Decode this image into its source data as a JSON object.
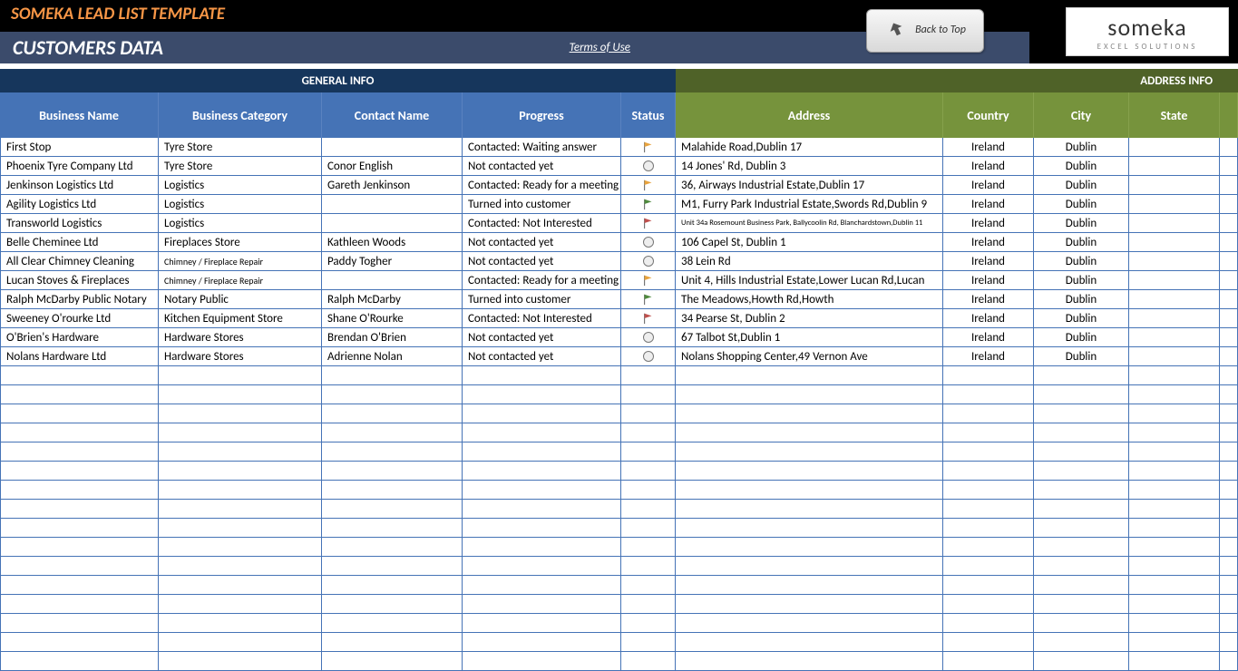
{
  "header": {
    "brand_title": "SOMEKA LEAD LIST TEMPLATE",
    "subtitle": "CUSTOMERS DATA",
    "terms_link": "Terms of Use",
    "back_button": "Back to Top",
    "logo_main": "someka",
    "logo_sub": "EXCEL SOLUTIONS"
  },
  "sections": {
    "general": "GENERAL INFO",
    "address": "ADDRESS INFO"
  },
  "columns": {
    "business_name": "Business Name",
    "business_category": "Business Category",
    "contact_name": "Contact Name",
    "progress": "Progress",
    "status": "Status",
    "address": "Address",
    "country": "Country",
    "city": "City",
    "state": "State"
  },
  "rows": [
    {
      "bn": "First Stop",
      "bc": "Tyre Store",
      "cn": "",
      "pr": "Contacted: Waiting answer",
      "st": "flag-orange",
      "ad": "Malahide Road,Dublin 17",
      "co": "Ireland",
      "ci": "Dublin",
      "sa": ""
    },
    {
      "bn": "Phoenix Tyre Company Ltd",
      "bc": "Tyre Store",
      "cn": "Conor English",
      "pr": "Not contacted yet",
      "st": "circle",
      "ad": "14 Jones' Rd, Dublin 3",
      "co": "Ireland",
      "ci": "Dublin",
      "sa": ""
    },
    {
      "bn": "Jenkinson Logistics Ltd",
      "bc": "Logistics",
      "cn": "Gareth Jenkinson",
      "pr": "Contacted: Ready for a meeting",
      "st": "flag-orange",
      "ad": "36, Airways Industrial Estate,Dublin 17",
      "co": "Ireland",
      "ci": "Dublin",
      "sa": ""
    },
    {
      "bn": "Agility Logistics Ltd",
      "bc": "Logistics",
      "cn": "",
      "pr": "Turned into customer",
      "st": "flag-green",
      "ad": "M1, Furry Park Industrial Estate,Swords Rd,Dublin 9",
      "co": "Ireland",
      "ci": "Dublin",
      "sa": ""
    },
    {
      "bn": "Transworld Logistics",
      "bc": "Logistics",
      "cn": "",
      "pr": "Contacted: Not Interested",
      "st": "flag-red",
      "ad": "Unit 34a Rosemount Business Park, Ballycoolin Rd, Blanchardstown,Dublin 11",
      "ad_xs": true,
      "co": "Ireland",
      "ci": "Dublin",
      "sa": ""
    },
    {
      "bn": "Belle Cheminee Ltd",
      "bc": "Fireplaces Store",
      "cn": "Kathleen Woods",
      "pr": "Not contacted yet",
      "st": "circle",
      "ad": "106 Capel St, Dublin 1",
      "co": "Ireland",
      "ci": "Dublin",
      "sa": ""
    },
    {
      "bn": "All Clear Chimney Cleaning",
      "bc": "Chimney / Fireplace Repair",
      "bc_sm": true,
      "cn": "Paddy Togher",
      "pr": "Not contacted yet",
      "st": "circle",
      "ad": "38 Lein Rd",
      "co": "Ireland",
      "ci": "Dublin",
      "sa": ""
    },
    {
      "bn": "Lucan Stoves & Fireplaces",
      "bc": "Chimney / Fireplace Repair",
      "bc_sm": true,
      "cn": "",
      "pr": "Contacted: Ready for a meeting",
      "st": "flag-orange",
      "ad": "Unit 4, Hills Industrial Estate,Lower Lucan Rd,Lucan",
      "co": "Ireland",
      "ci": "Dublin",
      "sa": ""
    },
    {
      "bn": "Ralph McDarby Public Notary",
      "bc": "Notary Public",
      "cn": "Ralph McDarby",
      "pr": "Turned into customer",
      "st": "flag-green",
      "ad": "The Meadows,Howth Rd,Howth",
      "co": "Ireland",
      "ci": "Dublin",
      "sa": ""
    },
    {
      "bn": "Sweeney O'rourke Ltd",
      "bc": "Kitchen Equipment Store",
      "cn": "Shane O'Rourke",
      "pr": "Contacted: Not Interested",
      "st": "flag-red",
      "ad": "34 Pearse St, Dublin 2",
      "co": "Ireland",
      "ci": "Dublin",
      "sa": ""
    },
    {
      "bn": "O'Brien's Hardware",
      "bc": "Hardware Stores",
      "cn": "Brendan O'Brien",
      "pr": "Not contacted yet",
      "st": "circle",
      "ad": "67 Talbot St,Dublin 1",
      "co": "Ireland",
      "ci": "Dublin",
      "sa": ""
    },
    {
      "bn": "Nolans Hardware Ltd",
      "bc": "Hardware Stores",
      "cn": "Adrienne Nolan",
      "pr": "Not contacted yet",
      "st": "circle",
      "ad": "Nolans Shopping Center,49 Vernon Ave",
      "co": "Ireland",
      "ci": "Dublin",
      "sa": ""
    }
  ],
  "empty_rows": 16
}
